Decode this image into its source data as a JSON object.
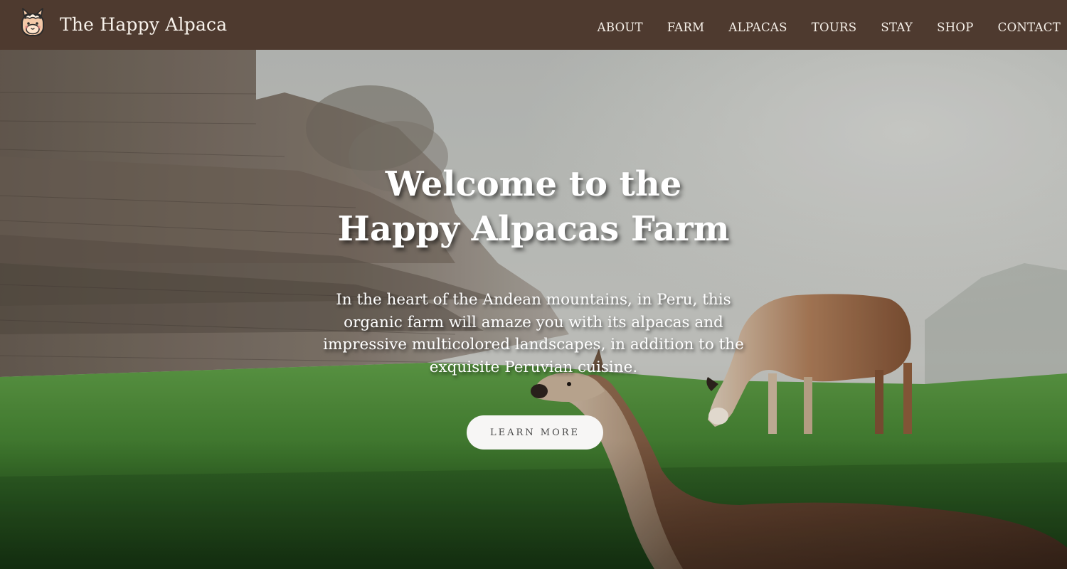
{
  "header": {
    "brand_name": "The Happy Alpaca",
    "logo_icon": "alpaca-face-icon",
    "nav": [
      {
        "label": "ABOUT"
      },
      {
        "label": "FARM"
      },
      {
        "label": "ALPACAS"
      },
      {
        "label": "TOURS"
      },
      {
        "label": "STAY"
      },
      {
        "label": "SHOP"
      },
      {
        "label": "CONTACT"
      }
    ]
  },
  "hero": {
    "title_line1": "Welcome to the",
    "title_line2": "Happy Alpacas Farm",
    "description": "In the heart of the Andean mountains, in Peru, this organic farm will amaze you with its alpacas and impressive multicolored landscapes, in addition to the exquisite Peruvian cuisine.",
    "cta_label": "LEARN MORE"
  },
  "colors": {
    "navbar_bg": "#4e3a2f",
    "nav_text": "#f7f1ea",
    "hero_text": "#ffffff",
    "button_bg": "#f7f6f5",
    "button_text": "#4a4a4a"
  }
}
